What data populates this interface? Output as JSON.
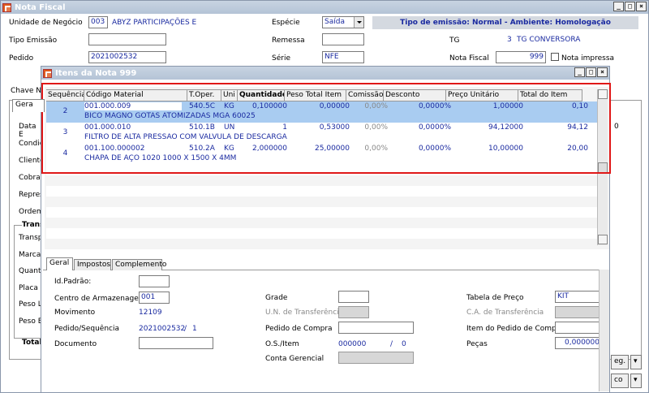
{
  "main": {
    "title": "Nota Fiscal",
    "unidade_label": "Unidade de Negócio",
    "unidade_code": "003",
    "unidade_name": "ABYZ PARTICIPAÇÕES E",
    "especie_label": "Espécie",
    "especie_value": "Saída",
    "banner": "Tipo de emissão: Normal - Ambiente: Homologação",
    "tipo_emissao_label": "Tipo Emissão",
    "remessa_label": "Remessa",
    "tg_label": "TG",
    "tg_code": "3",
    "tg_name": "TG CONVERSORA",
    "pedido_label": "Pedido",
    "pedido_value": "2021002532",
    "serie_label": "Série",
    "serie_value": "NFE",
    "nota_fiscal_label": "Nota Fiscal",
    "nota_fiscal_value": "999",
    "nota_impressa_label": "Nota impressa",
    "chave_label": "Chave NF",
    "gera_tab": "Gera",
    "side_labels": [
      "Data E",
      "Condiç",
      "Cliente",
      "Cobrar",
      "Repres",
      "Ordem"
    ],
    "trans_group": "Trans",
    "trans_labels": [
      "Transp",
      "Marca",
      "Quant",
      "Placa",
      "Peso L",
      "Peso E"
    ],
    "total_label": "Total",
    "right_fragment": "0",
    "btn_1": "eg.",
    "btn_2": "co"
  },
  "items": {
    "title": "Itens da Nota 999",
    "columns": [
      "Sequência",
      "Código Material",
      "T.Oper.",
      "Uni",
      "Quantidade",
      "Peso Total Item",
      "Comissão",
      "Desconto",
      "Preço Unitário",
      "Total do Item"
    ],
    "rows": [
      {
        "seq": "2",
        "codigo": "001.000.009",
        "toper": "540.5C",
        "uni": "KG",
        "qtd": "0,100000",
        "peso": "0,00000",
        "comissao": "0,00%",
        "desconto": "0,0000%",
        "preco": "1,00000",
        "total": "0,10",
        "descricao": "BICO MAGNO GOTAS ATOMIZADAS MGA 60025"
      },
      {
        "seq": "3",
        "codigo": "001.000.010",
        "toper": "510.1B",
        "uni": "UN",
        "qtd": "1",
        "peso": "0,53000",
        "comissao": "0,00%",
        "desconto": "0,0000%",
        "preco": "94,12000",
        "total": "94,12",
        "descricao": "FILTRO DE ALTA PRESSAO COM VALVULA DE DESCARGA"
      },
      {
        "seq": "4",
        "codigo": "001.100.000002",
        "toper": "510.2A",
        "uni": "KG",
        "qtd": "2,000000",
        "peso": "25,00000",
        "comissao": "0,00%",
        "desconto": "0,0000%",
        "preco": "10,00000",
        "total": "20,00",
        "descricao": "CHAPA DE AÇO 1020 1000 X 1500  X 4MM"
      }
    ],
    "tabs": [
      "Geral",
      "Impostos",
      "Complemento"
    ],
    "form": {
      "id_padrao_label": "Id.Padrão:",
      "centro_label": "Centro de Armazenagem",
      "centro_value": "001",
      "movimento_label": "Movimento",
      "movimento_value": "12109",
      "pedido_seq_label": "Pedido/Sequência",
      "pedido_value": "2021002532",
      "pedido_seq_sep": "/",
      "pedido_seq_value": "1",
      "documento_label": "Documento",
      "grade_label": "Grade",
      "un_transf_label": "U.N. de Transferência",
      "pedido_compra_label": "Pedido de Compra",
      "os_item_label": "O.S./Item",
      "os_value": "000000",
      "os_sep": "/",
      "os_item_value": "0",
      "conta_gerencial_label": "Conta Gerencial",
      "tabela_preco_label": "Tabela de Preço",
      "tabela_preco_value": "KIT",
      "ca_transf_label": "C.A. de Transferência",
      "item_pedido_compra_label": "Item do Pedido de Compra",
      "pecas_label": "Peças",
      "pecas_value": "0,000000"
    }
  },
  "colors": {
    "selection_highlight": "#e01818",
    "selected_row": "#a9ccf1",
    "field_text": "#1a2aa0",
    "title_gradient": "#b4c3d6"
  }
}
